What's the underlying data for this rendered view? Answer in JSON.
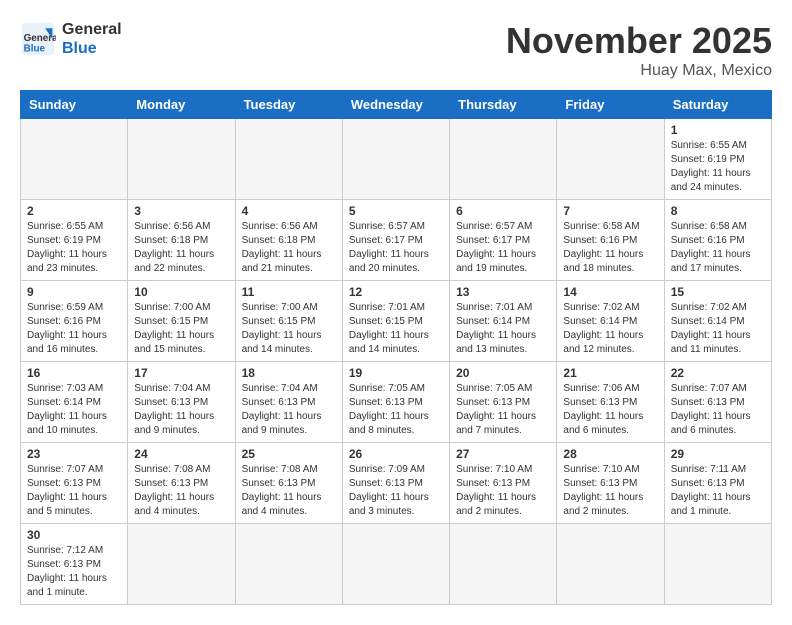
{
  "logo": {
    "line1": "General",
    "line2": "Blue"
  },
  "title": "November 2025",
  "location": "Huay Max, Mexico",
  "weekdays": [
    "Sunday",
    "Monday",
    "Tuesday",
    "Wednesday",
    "Thursday",
    "Friday",
    "Saturday"
  ],
  "weeks": [
    [
      {
        "day": "",
        "info": ""
      },
      {
        "day": "",
        "info": ""
      },
      {
        "day": "",
        "info": ""
      },
      {
        "day": "",
        "info": ""
      },
      {
        "day": "",
        "info": ""
      },
      {
        "day": "",
        "info": ""
      },
      {
        "day": "1",
        "info": "Sunrise: 6:55 AM\nSunset: 6:19 PM\nDaylight: 11 hours and 24 minutes."
      }
    ],
    [
      {
        "day": "2",
        "info": "Sunrise: 6:55 AM\nSunset: 6:19 PM\nDaylight: 11 hours and 23 minutes."
      },
      {
        "day": "3",
        "info": "Sunrise: 6:56 AM\nSunset: 6:18 PM\nDaylight: 11 hours and 22 minutes."
      },
      {
        "day": "4",
        "info": "Sunrise: 6:56 AM\nSunset: 6:18 PM\nDaylight: 11 hours and 21 minutes."
      },
      {
        "day": "5",
        "info": "Sunrise: 6:57 AM\nSunset: 6:17 PM\nDaylight: 11 hours and 20 minutes."
      },
      {
        "day": "6",
        "info": "Sunrise: 6:57 AM\nSunset: 6:17 PM\nDaylight: 11 hours and 19 minutes."
      },
      {
        "day": "7",
        "info": "Sunrise: 6:58 AM\nSunset: 6:16 PM\nDaylight: 11 hours and 18 minutes."
      },
      {
        "day": "8",
        "info": "Sunrise: 6:58 AM\nSunset: 6:16 PM\nDaylight: 11 hours and 17 minutes."
      }
    ],
    [
      {
        "day": "9",
        "info": "Sunrise: 6:59 AM\nSunset: 6:16 PM\nDaylight: 11 hours and 16 minutes."
      },
      {
        "day": "10",
        "info": "Sunrise: 7:00 AM\nSunset: 6:15 PM\nDaylight: 11 hours and 15 minutes."
      },
      {
        "day": "11",
        "info": "Sunrise: 7:00 AM\nSunset: 6:15 PM\nDaylight: 11 hours and 14 minutes."
      },
      {
        "day": "12",
        "info": "Sunrise: 7:01 AM\nSunset: 6:15 PM\nDaylight: 11 hours and 14 minutes."
      },
      {
        "day": "13",
        "info": "Sunrise: 7:01 AM\nSunset: 6:14 PM\nDaylight: 11 hours and 13 minutes."
      },
      {
        "day": "14",
        "info": "Sunrise: 7:02 AM\nSunset: 6:14 PM\nDaylight: 11 hours and 12 minutes."
      },
      {
        "day": "15",
        "info": "Sunrise: 7:02 AM\nSunset: 6:14 PM\nDaylight: 11 hours and 11 minutes."
      }
    ],
    [
      {
        "day": "16",
        "info": "Sunrise: 7:03 AM\nSunset: 6:14 PM\nDaylight: 11 hours and 10 minutes."
      },
      {
        "day": "17",
        "info": "Sunrise: 7:04 AM\nSunset: 6:13 PM\nDaylight: 11 hours and 9 minutes."
      },
      {
        "day": "18",
        "info": "Sunrise: 7:04 AM\nSunset: 6:13 PM\nDaylight: 11 hours and 9 minutes."
      },
      {
        "day": "19",
        "info": "Sunrise: 7:05 AM\nSunset: 6:13 PM\nDaylight: 11 hours and 8 minutes."
      },
      {
        "day": "20",
        "info": "Sunrise: 7:05 AM\nSunset: 6:13 PM\nDaylight: 11 hours and 7 minutes."
      },
      {
        "day": "21",
        "info": "Sunrise: 7:06 AM\nSunset: 6:13 PM\nDaylight: 11 hours and 6 minutes."
      },
      {
        "day": "22",
        "info": "Sunrise: 7:07 AM\nSunset: 6:13 PM\nDaylight: 11 hours and 6 minutes."
      }
    ],
    [
      {
        "day": "23",
        "info": "Sunrise: 7:07 AM\nSunset: 6:13 PM\nDaylight: 11 hours and 5 minutes."
      },
      {
        "day": "24",
        "info": "Sunrise: 7:08 AM\nSunset: 6:13 PM\nDaylight: 11 hours and 4 minutes."
      },
      {
        "day": "25",
        "info": "Sunrise: 7:08 AM\nSunset: 6:13 PM\nDaylight: 11 hours and 4 minutes."
      },
      {
        "day": "26",
        "info": "Sunrise: 7:09 AM\nSunset: 6:13 PM\nDaylight: 11 hours and 3 minutes."
      },
      {
        "day": "27",
        "info": "Sunrise: 7:10 AM\nSunset: 6:13 PM\nDaylight: 11 hours and 2 minutes."
      },
      {
        "day": "28",
        "info": "Sunrise: 7:10 AM\nSunset: 6:13 PM\nDaylight: 11 hours and 2 minutes."
      },
      {
        "day": "29",
        "info": "Sunrise: 7:11 AM\nSunset: 6:13 PM\nDaylight: 11 hours and 1 minute."
      }
    ],
    [
      {
        "day": "30",
        "info": "Sunrise: 7:12 AM\nSunset: 6:13 PM\nDaylight: 11 hours and 1 minute."
      },
      {
        "day": "",
        "info": ""
      },
      {
        "day": "",
        "info": ""
      },
      {
        "day": "",
        "info": ""
      },
      {
        "day": "",
        "info": ""
      },
      {
        "day": "",
        "info": ""
      },
      {
        "day": "",
        "info": ""
      }
    ]
  ]
}
